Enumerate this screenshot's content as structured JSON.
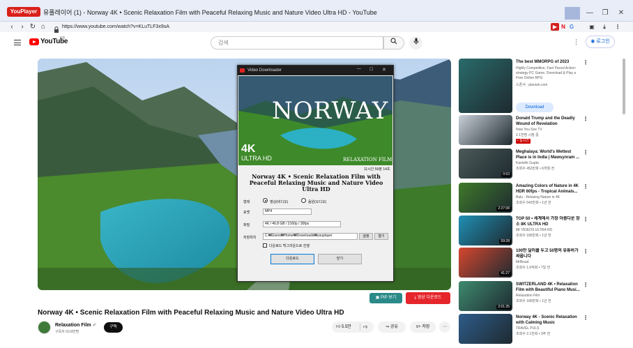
{
  "window": {
    "app_logo": "YouPlayer",
    "title": "유플레이어 (1) - Norway 4K • Scenic Relaxation Film with Peaceful Relaxing Music and Nature Video Ultra HD - YouTube",
    "min": "—",
    "restore": "❐",
    "close": "✕"
  },
  "browser": {
    "url": "https://www.youtube.com/watch?v=KLuTLF3x9sA",
    "back": "‹",
    "forward": "›",
    "reload": "↻",
    "home": "⌂"
  },
  "youtube": {
    "logo_text": "YouTube",
    "region": "KR",
    "search_placeholder": "검색",
    "login_label": "로그인"
  },
  "dialog": {
    "title": "Video Downloader",
    "thumb_title": "NORWAY",
    "thumb_4k": "4K",
    "thumb_uhd": "ULTRA HD",
    "thumb_brand": "RELAXATION FILM",
    "duration": "11시간 59분 14초",
    "video_title": "Norway 4K • Scenic Relaxation Film with Peaceful Relaxing Music and Nature Video Ultra HD",
    "type_label": "형태",
    "type_video": "영상(비디오)",
    "type_audio": "음원(오디오)",
    "type_selected": "video",
    "format_label": "포맷",
    "format_value": "MP4",
    "quality_label": "화질",
    "quality_value": "4K / 46.8 GB / 2160p / 30fps",
    "path_label": "저장위치",
    "path_value": "C:₩Users₩Home₩Downloads₩youplayer",
    "settings_btn": "설정",
    "open_btn": "열기",
    "background_checkbox": "다운로드 백그라운드로 진행",
    "download_btn": "다운로드",
    "close_btn": "닫기"
  },
  "player_actions": {
    "pip_label": "PIP 보기",
    "download_label": "영상 다운로드"
  },
  "video": {
    "title": "Norway 4K • Scenic Relaxation Film with Peaceful Relaxing Music and Nature Video Ultra HD",
    "channel": "Relaxation Film",
    "subscribers": "구독자 63.8만명",
    "subscribe_label": "구독",
    "likes": "5.5만",
    "share_label": "공유",
    "save_label": "저장"
  },
  "sidebar": [
    {
      "title": "The best MMORPG of 2023",
      "meta1": "Highly Competitive, Fast Paced Action-strategy PC Game. Download & Play a Free Online RPG",
      "meta2": "스폰서 · plarium.com",
      "cta": "Download",
      "thumb": "#2a6b6a",
      "duration": ""
    },
    {
      "title": "Donald Trump and the Deadly Wound of Revelation",
      "meta1": "Now You See TV",
      "meta2": "2.1천명 시청 중",
      "badge": "• 실시간",
      "thumb": "#c9cfd8",
      "duration": ""
    },
    {
      "title": "Meghalaya: World's Wettest Place is in India | Mawsynram ...",
      "meta1": "Kanishk Gupta",
      "meta2": "조회수 452만회 • 6개월 전",
      "thumb": "#4c5a58",
      "duration": "0:53"
    },
    {
      "title": "Amazing Colors of Nature in 4K HDR 60fps - Tropical Animals...",
      "meta1": "Balu - Relaxing Nature in 4K",
      "meta2": "조회수 542만회 • 1년 전",
      "thumb": "#3f7a2a",
      "duration": "2:27:08"
    },
    {
      "title": "TOP 50 • 세계에서 가장 아름다운 장소 8K ULTRA HD",
      "meta1": "8K VIDEOS ULTRA HD",
      "meta2": "조회수 185만회 • 1년 전",
      "thumb": "#1f8fb4",
      "duration": "59:28"
    },
    {
      "title": "100만 달러를 두고 50명의 유튜버가 싸웁니다",
      "meta1": "MrBeast",
      "meta2": "조회수 1.6억회 • 7일 전",
      "thumb": "#d6472f",
      "duration": "41:27"
    },
    {
      "title": "SWITZERLAND 4K • Relaxation Film with Beautiful Piano Musi...",
      "meta1": "Relaxation Film",
      "meta2": "조회수 180만회 • 1년 전",
      "thumb": "#3e8a6e",
      "duration": "2:01:35"
    },
    {
      "title": "Norway 4K - Scenic Relaxation with Calming Music",
      "meta1": "TRAVEL PULS",
      "meta2": "조회수 2.1천회 • 3주 전",
      "thumb": "#2e5c8a",
      "duration": ""
    }
  ]
}
